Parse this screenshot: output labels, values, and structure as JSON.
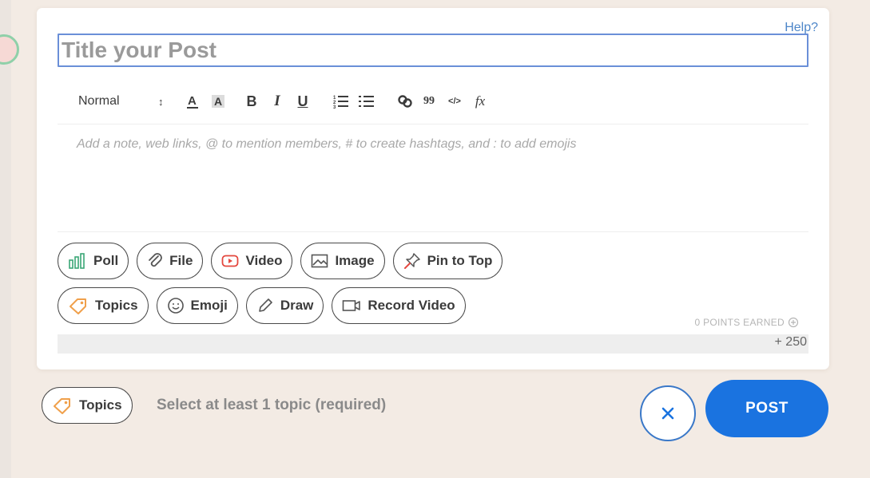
{
  "header": {
    "help_link": "Help?"
  },
  "title_input": {
    "placeholder": "Title your Post",
    "value": ""
  },
  "toolbar": {
    "style_select": "Normal",
    "buttons": [
      {
        "icon": "text-color-icon"
      },
      {
        "icon": "highlight-icon"
      },
      {
        "label": "B",
        "icon": "bold-icon"
      },
      {
        "label": "I",
        "icon": "italic-icon"
      },
      {
        "label": "U",
        "icon": "underline-icon"
      },
      {
        "icon": "ordered-list-icon"
      },
      {
        "icon": "bullet-list-icon"
      },
      {
        "icon": "link-icon"
      },
      {
        "label": "99",
        "icon": "quote-icon"
      },
      {
        "label": "</>",
        "icon": "code-icon"
      },
      {
        "label": "fx",
        "icon": "formula-icon"
      }
    ]
  },
  "editor": {
    "placeholder": "Add a note, web links, @ to mention members, # to create hashtags, and : to add emojis"
  },
  "attachments": {
    "row1": [
      {
        "label": "Poll",
        "icon": "poll-icon"
      },
      {
        "label": "File",
        "icon": "paperclip-icon"
      },
      {
        "label": "Video",
        "icon": "video-icon"
      },
      {
        "label": "Image",
        "icon": "image-icon"
      },
      {
        "label": "Pin to Top",
        "icon": "pin-icon"
      }
    ],
    "row2": [
      {
        "label": "Topics",
        "icon": "tag-icon"
      },
      {
        "label": "Emoji",
        "icon": "smile-icon"
      },
      {
        "label": "Draw",
        "icon": "pencil-icon"
      },
      {
        "label": "Record Video",
        "icon": "camera-icon"
      }
    ]
  },
  "points": {
    "label": "0 POINTS EARNED",
    "value": "+ 250"
  },
  "footer": {
    "topics_label": "Topics",
    "required_text": "Select at least 1 topic (required)",
    "post_label": "POST"
  },
  "colors": {
    "background": "#f3ebe4",
    "accent": "#1a73e0",
    "tag_orange": "#f0a04b",
    "video_red": "#e4473e",
    "poll_green": "#3aa776"
  }
}
